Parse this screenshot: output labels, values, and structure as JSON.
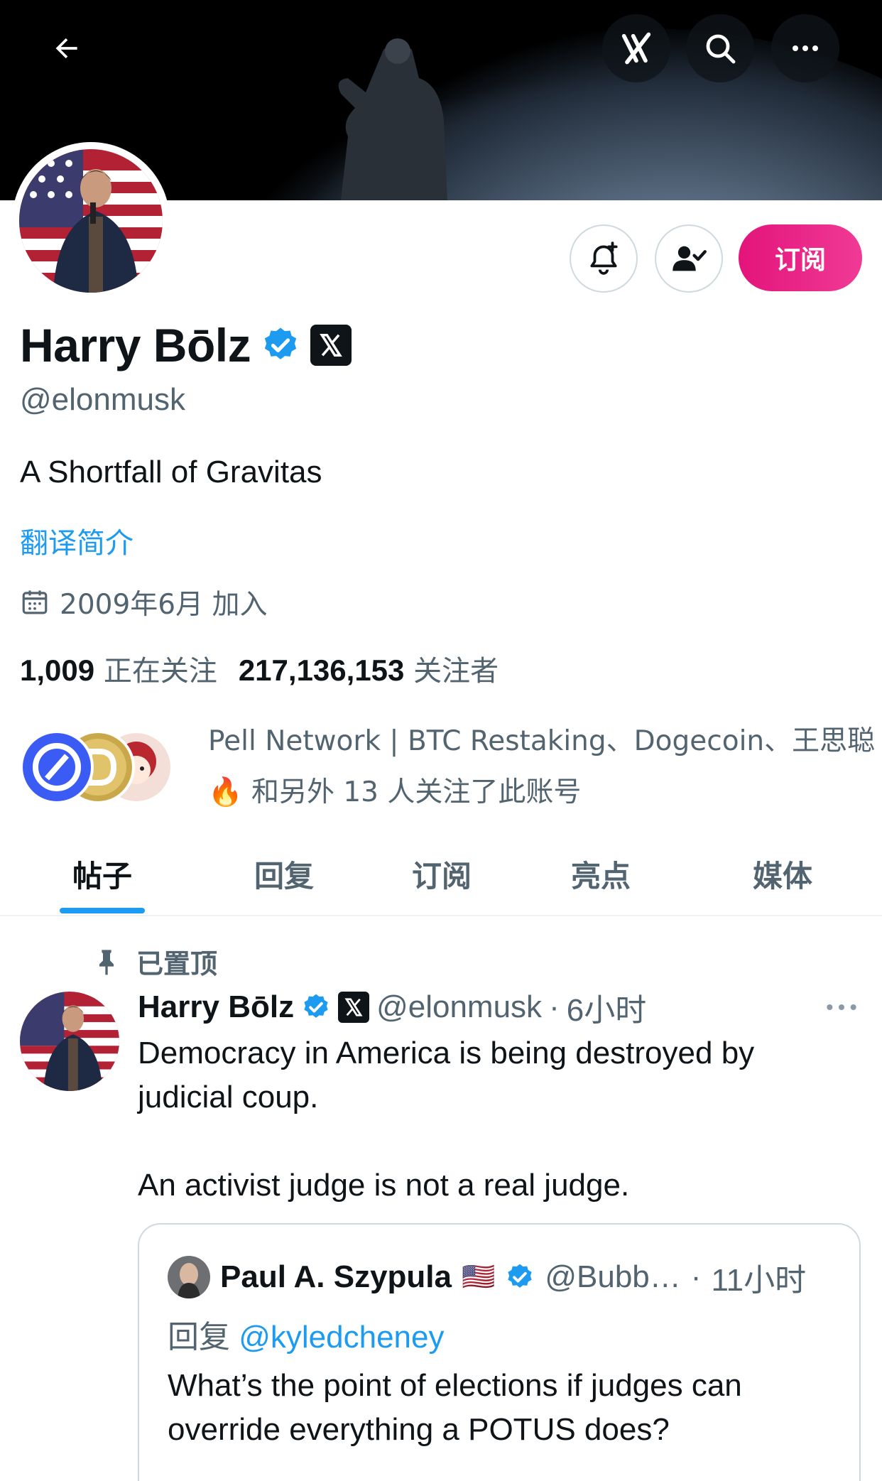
{
  "profile": {
    "name": "Harry Bōlz",
    "handle": "@elonmusk",
    "bio": "A Shortfall of Gravitas",
    "translate_label": "翻译简介",
    "joined": "2009年6月 加入",
    "following_count": "1,009",
    "following_label": "正在关注",
    "followers_count": "217,136,153",
    "followers_label": "关注者",
    "known_followers": "Pell Network | BTC Restaking、Dogecoin、王思聪🔥 和另外 13 人关注了此账号"
  },
  "actions": {
    "subscribe_label": "订阅"
  },
  "tabs": [
    {
      "label": "帖子",
      "active": true
    },
    {
      "label": "回复",
      "active": false
    },
    {
      "label": "订阅",
      "active": false
    },
    {
      "label": "亮点",
      "active": false
    },
    {
      "label": "媒体",
      "active": false
    }
  ],
  "post": {
    "pinned_label": "已置顶",
    "author": "Harry Bōlz",
    "handle": "@elonmusk",
    "separator": "·",
    "time": "6小时",
    "text_line1": "Democracy in America is being destroyed by judicial coup.",
    "text_line2": "An activist judge is not a real judge.",
    "quote": {
      "author": "Paul A. Szypula",
      "flag": "🇺🇸",
      "handle": "@Bubb…",
      "separator": "·",
      "time": "11小时",
      "reply_prefix": "回复",
      "reply_to": "@kyledcheney",
      "text": "What’s the point of elections if judges can override everything a POTUS does?"
    }
  },
  "colors": {
    "accent": "#1d9bf0",
    "subscribe": "#e3147a",
    "muted": "#536471",
    "text": "#0f1419"
  },
  "icons": [
    "back-arrow-icon",
    "grok-icon",
    "search-icon",
    "more-icon",
    "bell-plus-icon",
    "user-check-icon",
    "verified-icon",
    "x-logo-icon",
    "calendar-icon",
    "pin-icon"
  ]
}
